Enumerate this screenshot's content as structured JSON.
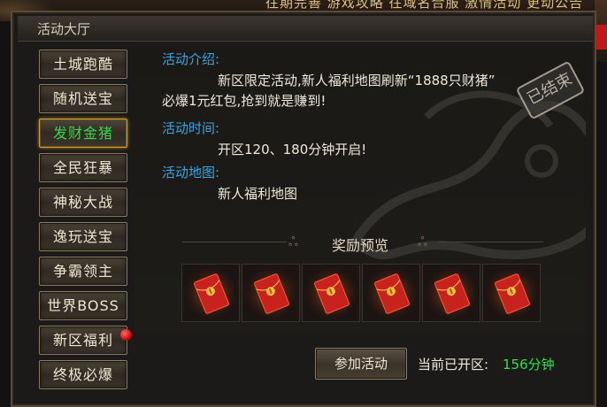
{
  "top_links": "往期完善  游戏攻略  往域名合服  激情活动  更动公告",
  "window": {
    "title": "活动大厅"
  },
  "sidebar": {
    "items": [
      {
        "label": "土城跑酷"
      },
      {
        "label": "随机送宝"
      },
      {
        "label": "发财金猪",
        "active": true
      },
      {
        "label": "全民狂暴"
      },
      {
        "label": "神秘大战"
      },
      {
        "label": "逸玩送宝"
      },
      {
        "label": "争霸领主"
      },
      {
        "label": "世界BOSS"
      },
      {
        "label": "新区福利",
        "badge": true
      },
      {
        "label": "终极必爆"
      }
    ]
  },
  "detail": {
    "intro_label": "活动介绍:",
    "intro_line1": "新区限定活动,新人福利地图刷新“1888只财猪”",
    "intro_line2": "必爆1元红包,抢到就是赚到!",
    "time_label": "活动时间:",
    "time_text": "开区120、180分钟开启!",
    "map_label": "活动地图:",
    "map_text": "新人福利地图",
    "status_stamp": "已结束"
  },
  "rewards": {
    "title": "奖励预览",
    "items": [
      {
        "icon": "red-envelope-icon"
      },
      {
        "icon": "red-envelope-icon"
      },
      {
        "icon": "red-envelope-icon"
      },
      {
        "icon": "red-envelope-icon"
      },
      {
        "icon": "red-envelope-icon"
      },
      {
        "icon": "red-envelope-icon"
      }
    ]
  },
  "footer": {
    "join_label": "参加活动",
    "opened_label": "当前已开区:",
    "opened_value": "156分钟"
  },
  "colors": {
    "label_blue": "#37a4e3",
    "active_green": "#34d94a",
    "value_green": "#2fe34a",
    "envelope_red": "#c8221c"
  }
}
